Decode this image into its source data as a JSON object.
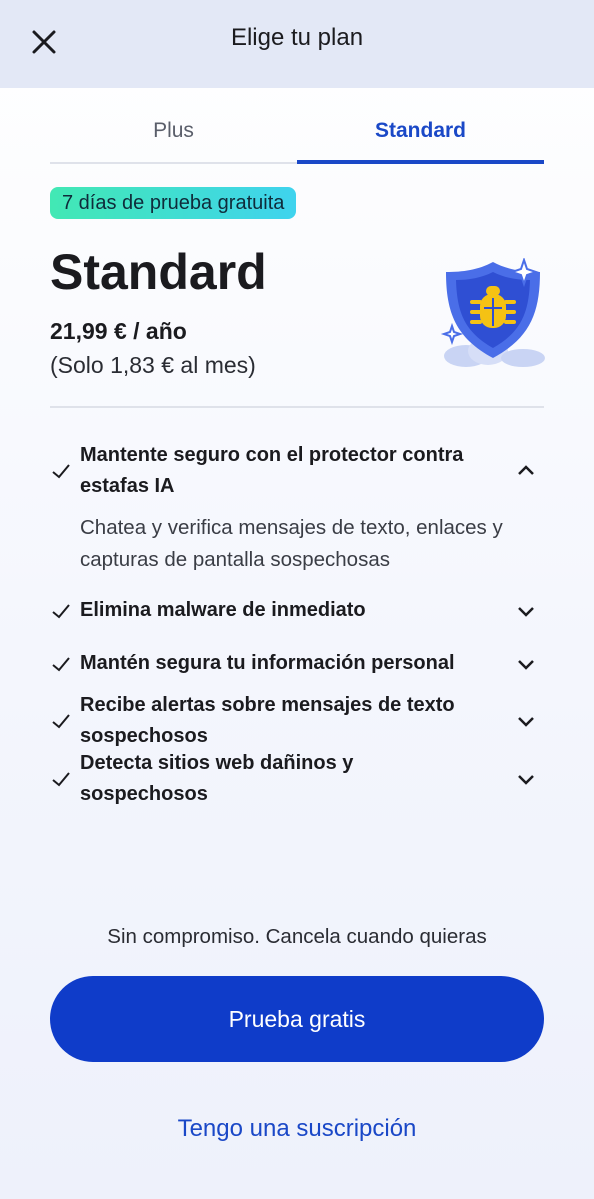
{
  "header": {
    "title": "Elige tu plan",
    "close_icon": "close-icon"
  },
  "tabs": [
    {
      "label": "Plus",
      "active": false
    },
    {
      "label": "Standard",
      "active": true
    }
  ],
  "plan": {
    "trial_badge": "7 días de prueba gratuita",
    "name": "Standard",
    "price": "21,99 € / año",
    "monthly": "(Solo 1,83 € al mes)",
    "illustration": "shield-bug-icon"
  },
  "features": [
    {
      "title": "Mantente seguro con el protector contra estafas IA",
      "expanded": true,
      "description": "Chatea y verifica mensajes de texto, enlaces y capturas de pantalla sospechosas"
    },
    {
      "title": "Elimina malware de inmediato",
      "expanded": false
    },
    {
      "title": "Mantén segura tu información personal",
      "expanded": false
    },
    {
      "title": "Recibe alertas sobre mensajes de texto sospechosos",
      "expanded": false
    },
    {
      "title": "Detecta sitios web dañinos y sospechosos",
      "expanded": false
    }
  ],
  "footer": {
    "no_commitment": "Sin compromiso. Cancela cuando quieras",
    "cta_label": "Prueba gratis",
    "subscription_link": "Tengo una suscripción"
  },
  "colors": {
    "accent": "#1a48c7",
    "cta": "#0f3cc9",
    "badge_start": "#42e8b4",
    "badge_end": "#3fd3ee",
    "header_bg": "#e3e8f6",
    "shield": "#4a6ee8",
    "bug": "#f5c214"
  }
}
